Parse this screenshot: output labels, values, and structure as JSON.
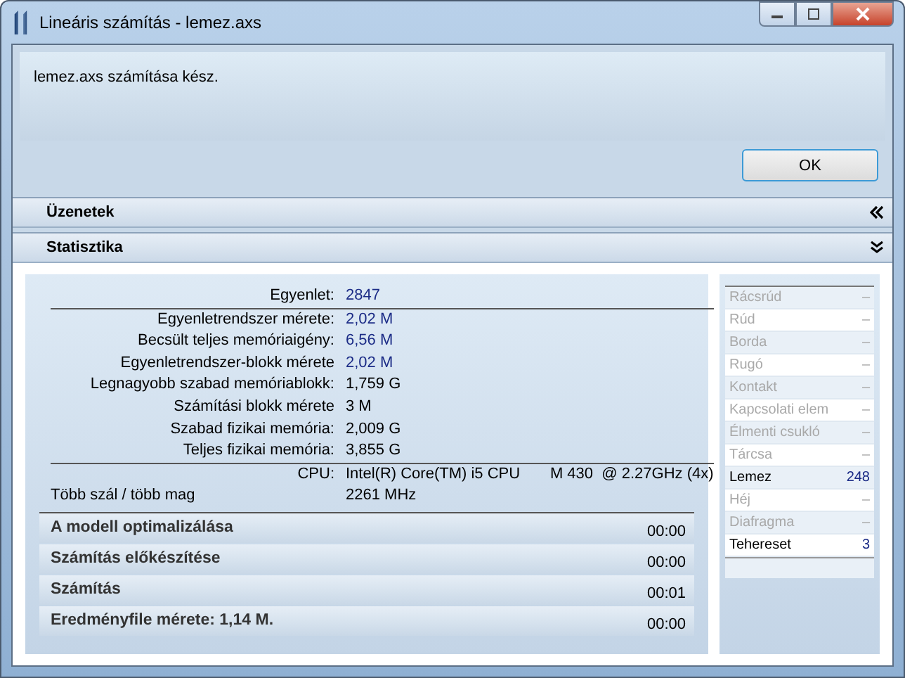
{
  "window": {
    "title": "Lineáris számítás - lemez.axs"
  },
  "message": "lemez.axs számítása kész.",
  "buttons": [
    "OK"
  ],
  "sections": [
    {
      "title": "Üzenetek",
      "expanded": false
    },
    {
      "title": "Statisztika",
      "expanded": true
    }
  ],
  "statistics": [
    {
      "label": "Egyenlet:",
      "value": "2847",
      "highlight": true
    },
    {
      "label": "Egyenletrendszer mérete:",
      "value": "2,02 M",
      "highlight": true
    },
    {
      "label": "Becsült teljes memóriaigény:",
      "value": "6,56 M",
      "highlight": true
    },
    {
      "label": "Egyenletrendszer-blokk mérete",
      "value": "2,02 M",
      "highlight": true
    },
    {
      "label": "Legnagyobb szabad memóriablokk:",
      "value": "1,759 G",
      "highlight": false
    },
    {
      "label": "Számítási blokk mérete",
      "value": "3 M",
      "highlight": false
    },
    {
      "label": "Szabad fizikai memória:",
      "value": "2,009 G",
      "highlight": false
    },
    {
      "label": "Teljes fizikai memória:",
      "value": "3,855 G",
      "highlight": false
    }
  ],
  "cpu": {
    "label": "CPU:",
    "value": "Intel(R) Core(TM) i5 CPU       M 430  @ 2.27GHz (4x)",
    "mode": "Több szál / több mag",
    "frequency": "2261 MHz"
  },
  "phases": [
    {
      "label": "A modell optimalizálása",
      "time": "00:00"
    },
    {
      "label": "Számítás előkészítése",
      "time": "00:00"
    },
    {
      "label": "Számítás",
      "time": "00:01"
    },
    {
      "label": "Eredményfile mérete: 1,14 M.",
      "time": "00:00"
    }
  ],
  "elements": [
    {
      "name": "Rácsrúd",
      "count": "–",
      "disabled": true
    },
    {
      "name": "Rúd",
      "count": "–",
      "disabled": true
    },
    {
      "name": "Borda",
      "count": "–",
      "disabled": true
    },
    {
      "name": "Rugó",
      "count": "–",
      "disabled": true
    },
    {
      "name": "Kontakt",
      "count": "–",
      "disabled": true
    },
    {
      "name": "Kapcsolati elem",
      "count": "–",
      "disabled": true
    },
    {
      "name": "Élmenti csukló",
      "count": "–",
      "disabled": true
    },
    {
      "name": "Tárcsa",
      "count": "–",
      "disabled": true
    },
    {
      "name": "Lemez",
      "count": "248",
      "disabled": false
    },
    {
      "name": "Héj",
      "count": "–",
      "disabled": true
    },
    {
      "name": "Diafragma",
      "count": "–",
      "disabled": true
    },
    {
      "name": "Tehereset",
      "count": "3",
      "disabled": false
    }
  ]
}
